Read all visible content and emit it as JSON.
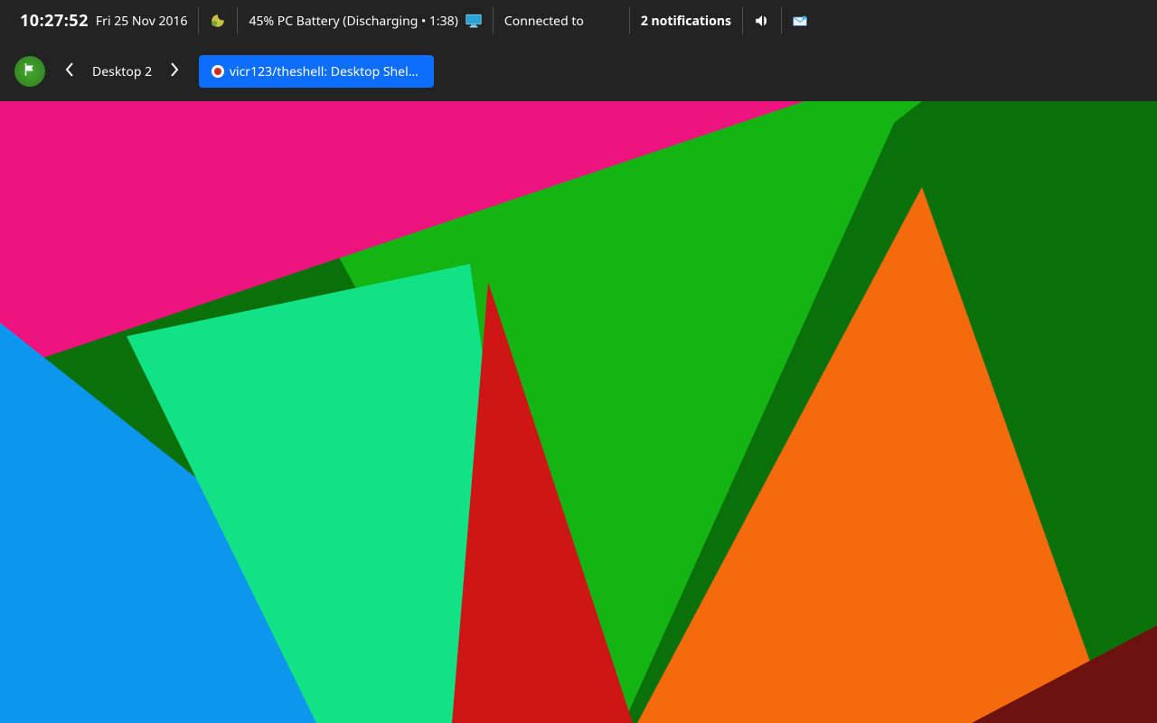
{
  "status": {
    "time": "10:27:52",
    "date": "Fri 25 Nov 2016",
    "battery": "45% PC Battery (Discharging • 1:38)",
    "network": "Connected to",
    "notifications": "2 notifications"
  },
  "taskbar": {
    "desktop_label": "Desktop 2",
    "window_title": "vicr123/theshell: Desktop Shell …"
  },
  "icons": {
    "weather": "weather-moon-icon",
    "monitor": "monitor-icon",
    "volume": "volume-icon",
    "mail": "mail-icon",
    "launcher": "launcher-flag-icon",
    "prev": "chevron-left-icon",
    "next": "chevron-right-icon"
  },
  "colors": {
    "panel": "#232323",
    "accent": "#0d6efd"
  }
}
